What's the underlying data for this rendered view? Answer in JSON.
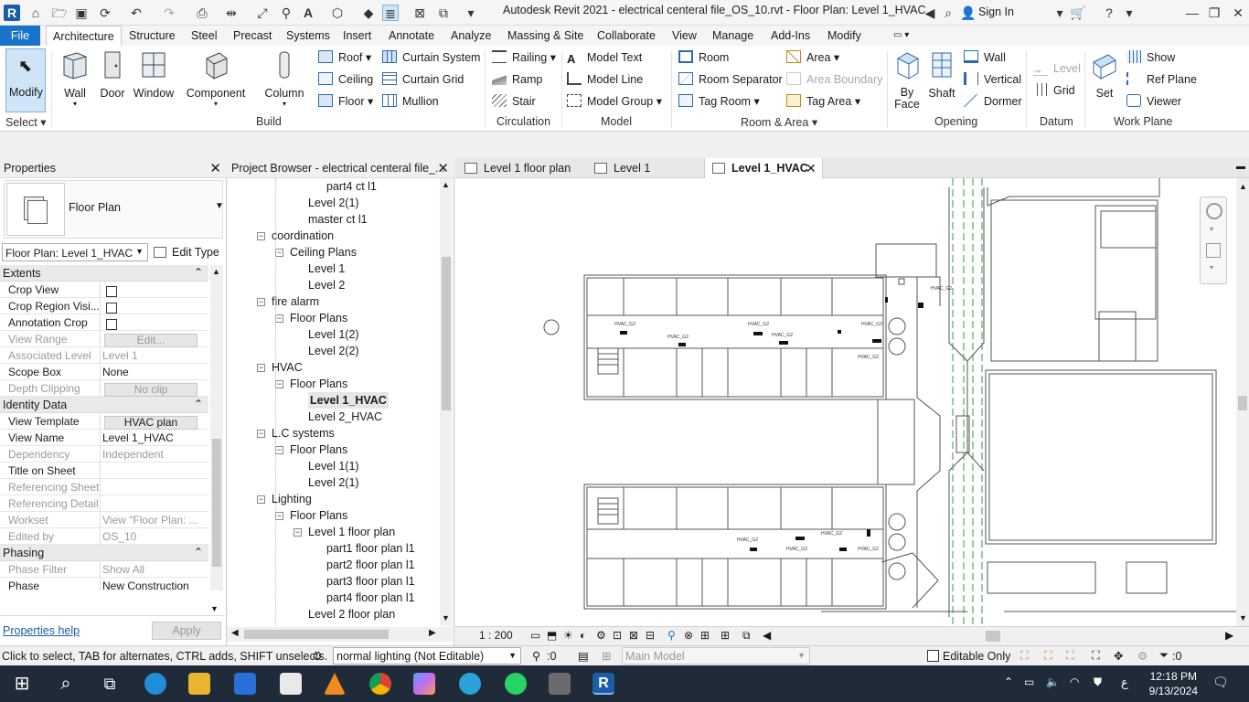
{
  "titlebar": {
    "title": "Autodesk Revit 2021 - electrical centeral file_OS_10.rvt - Floor Plan: Level 1_HVAC",
    "sign_in": "Sign In"
  },
  "ribbon_tabs": [
    "File",
    "Architecture",
    "Structure",
    "Steel",
    "Precast",
    "Systems",
    "Insert",
    "Annotate",
    "Analyze",
    "Massing & Site",
    "Collaborate",
    "View",
    "Manage",
    "Add-Ins",
    "Modify"
  ],
  "ribbon": {
    "modify": "Modify",
    "select": "Select",
    "build": {
      "label": "Build",
      "wall": "Wall",
      "door": "Door",
      "window": "Window",
      "component": "Component",
      "column": "Column",
      "roof": "Roof",
      "ceiling": "Ceiling",
      "floor": "Floor",
      "curtain_system": "Curtain System",
      "curtain_grid": "Curtain Grid",
      "mullion": "Mullion"
    },
    "circulation": {
      "label": "Circulation",
      "railing": "Railing",
      "ramp": "Ramp",
      "stair": "Stair"
    },
    "model": {
      "label": "Model",
      "model_text": "Model Text",
      "model_line": "Model Line",
      "model_group": "Model Group"
    },
    "room_area": {
      "label": "Room & Area",
      "room": "Room",
      "room_separator": "Room Separator",
      "tag_room": "Tag Room",
      "area": "Area",
      "area_boundary": "Area Boundary",
      "tag_area": "Tag Area"
    },
    "opening": {
      "label": "Opening",
      "by_face": "By",
      "by_face2": "Face",
      "shaft": "Shaft",
      "wall": "Wall",
      "vertical": "Vertical",
      "dormer": "Dormer"
    },
    "datum": {
      "label": "Datum",
      "level": "Level",
      "grid": "Grid"
    },
    "work_plane": {
      "label": "Work Plane",
      "set": "Set",
      "show": "Show",
      "ref_plane": "Ref Plane",
      "viewer": "Viewer"
    }
  },
  "properties": {
    "title": "Properties",
    "type_name": "Floor Plan",
    "selector": "Floor Plan: Level 1_HVAC",
    "edit_type": "Edit Type",
    "groups": {
      "extents": "Extents",
      "identity": "Identity Data",
      "phasing": "Phasing"
    },
    "rows": {
      "crop_view": "Crop View",
      "crop_region": "Crop Region Visi...",
      "annotation_crop": "Annotation Crop",
      "view_range": "View Range",
      "view_range_val": "Edit...",
      "associated_level": "Associated Level",
      "associated_level_val": "Level 1",
      "scope_box": "Scope Box",
      "scope_box_val": "None",
      "depth_clipping": "Depth Clipping",
      "depth_clipping_val": "No clip",
      "view_template": "View Template",
      "view_template_val": "HVAC plan",
      "view_name": "View Name",
      "view_name_val": "Level 1_HVAC",
      "dependency": "Dependency",
      "dependency_val": "Independent",
      "title_on_sheet": "Title on Sheet",
      "referencing_sheet": "Referencing Sheet",
      "referencing_detail": "Referencing Detail",
      "workset": "Workset",
      "workset_val": "View \"Floor Plan: ...",
      "edited_by": "Edited by",
      "edited_by_val": "OS_10",
      "phase_filter": "Phase Filter",
      "phase_filter_val": "Show All",
      "phase": "Phase",
      "phase_val": "New Construction"
    },
    "help": "Properties help",
    "apply": "Apply"
  },
  "browser": {
    "title": "Project Browser - electrical centeral file_...",
    "items": [
      "part4 ct l1",
      "Level 2(1)",
      "master ct l1",
      "coordination",
      "Ceiling Plans",
      "Level 1",
      "Level 2",
      "fire alarm",
      "Floor Plans",
      "Level 1(2)",
      "Level 2(2)",
      "HVAC",
      "Floor Plans",
      "Level 1_HVAC",
      "Level 2_HVAC",
      "L.C systems",
      "Floor Plans",
      "Level 1(1)",
      "Level 2(1)",
      "Lighting",
      "Floor Plans",
      "Level 1 floor plan",
      "part1 floor plan l1",
      "part2 floor plan l1",
      "part3 floor plan l1",
      "part4 floor plan l1",
      "Level 2 floor plan"
    ]
  },
  "view_tabs": [
    "Level 1 floor plan",
    "Level 1",
    "Level 1_HVAC"
  ],
  "view_control": {
    "scale": "1 : 200"
  },
  "statusbar": {
    "hint": "Click to select, TAB for alternates, CTRL adds, SHIFT unselects.",
    "workset": "normal lighting (Not Editable)",
    "count": ":0",
    "model": "Main Model",
    "editable_only": "Editable Only",
    "filter_count": ":0"
  },
  "taskbar": {
    "time": "12:18 PM",
    "date": "9/13/2024",
    "lang": "ع"
  },
  "colors": {
    "accent": "#1a73c9",
    "taskbar": "#1f2b38",
    "hvac_green": "#2e9d3a"
  }
}
